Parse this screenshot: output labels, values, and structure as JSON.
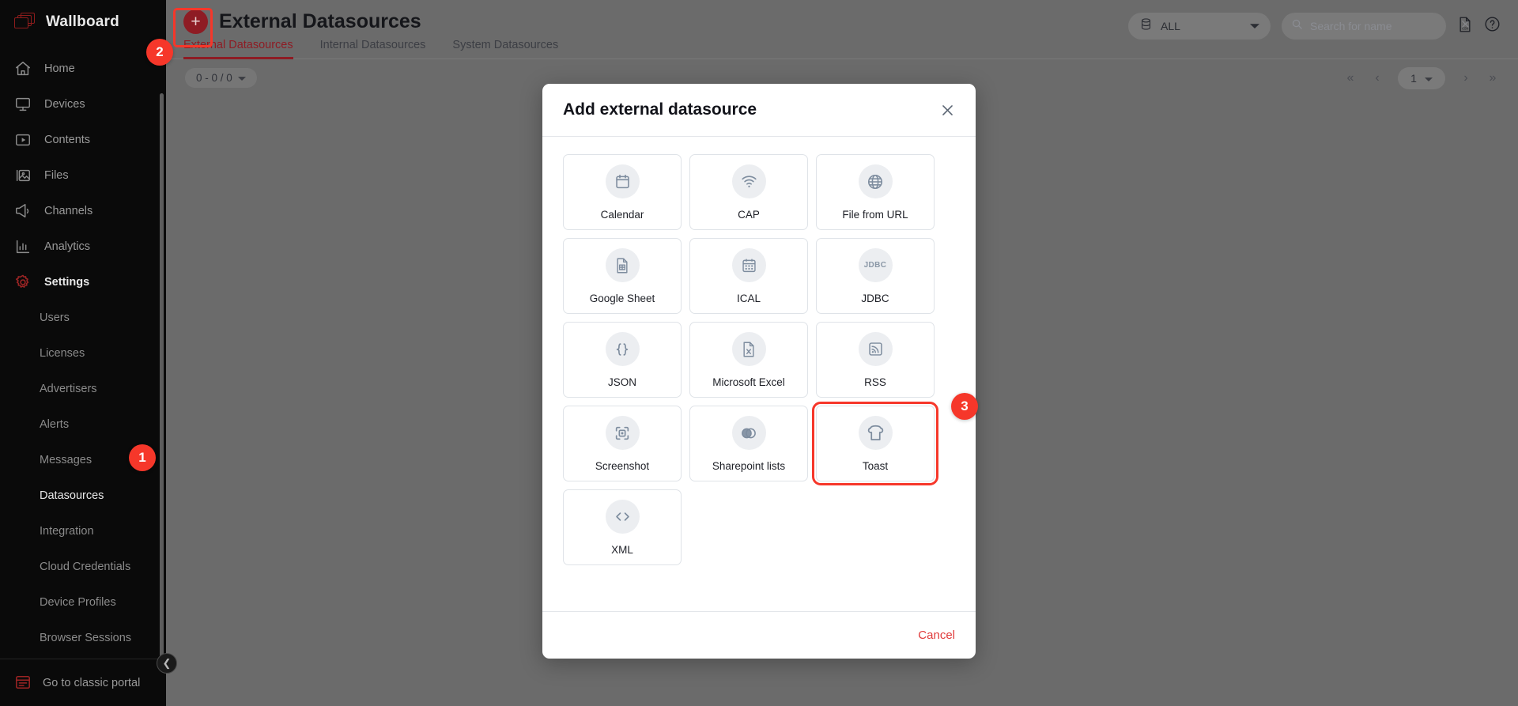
{
  "app": {
    "brand": "Wallboard"
  },
  "sidebar": {
    "main_items": [
      {
        "label": "Home",
        "icon": "home-icon"
      },
      {
        "label": "Devices",
        "icon": "monitor-icon"
      },
      {
        "label": "Contents",
        "icon": "play-box-icon"
      },
      {
        "label": "Files",
        "icon": "image-icon"
      },
      {
        "label": "Channels",
        "icon": "megaphone-icon"
      },
      {
        "label": "Analytics",
        "icon": "bar-chart-icon"
      },
      {
        "label": "Settings",
        "icon": "gear-icon"
      }
    ],
    "sub_items": [
      {
        "label": "Users"
      },
      {
        "label": "Licenses"
      },
      {
        "label": "Advertisers"
      },
      {
        "label": "Alerts"
      },
      {
        "label": "Messages"
      },
      {
        "label": "Datasources"
      },
      {
        "label": "Integration"
      },
      {
        "label": "Cloud Credentials"
      },
      {
        "label": "Device Profiles"
      },
      {
        "label": "Browser Sessions"
      }
    ],
    "selected_sub_item": "Datasources",
    "footer": {
      "label": "Go to classic portal",
      "icon": "classic-portal-icon"
    },
    "collapse_icon": "chevron-left-icon"
  },
  "header": {
    "title": "External Datasources",
    "add_button_icon": "plus-icon",
    "tabs": [
      {
        "label": "External Datasources",
        "active": true
      },
      {
        "label": "Internal Datasources",
        "active": false
      },
      {
        "label": "System Datasources",
        "active": false
      }
    ],
    "scope_select": {
      "value": "ALL",
      "icon": "database-icon",
      "chevron": "chevron-down-icon"
    },
    "search": {
      "value": "",
      "placeholder": "Search for name",
      "icon": "search-icon",
      "clear_icon": "close-icon"
    },
    "export_icon": "csv-file-icon",
    "help_icon": "help-circle-icon"
  },
  "list_toolbar": {
    "count_label": "0 - 0 / 0",
    "count_chevron": "chevron-down-icon",
    "pager": {
      "first_icon": "chevrons-left-icon",
      "prev_icon": "chevron-left-icon",
      "page_value": "1",
      "page_chevron": "chevron-down-icon",
      "next_icon": "chevron-right-icon",
      "last_icon": "chevrons-right-icon"
    }
  },
  "modal": {
    "title": "Add external datasource",
    "close_icon": "close-icon",
    "cancel_label": "Cancel",
    "tiles": [
      {
        "label": "Calendar",
        "icon": "calendar-icon",
        "highlighted": false
      },
      {
        "label": "CAP",
        "icon": "signal-wifi-icon",
        "highlighted": false
      },
      {
        "label": "File from URL",
        "icon": "globe-icon",
        "highlighted": false
      },
      {
        "label": "Google Sheet",
        "icon": "sheet-document-icon",
        "highlighted": false
      },
      {
        "label": "ICAL",
        "icon": "calendar-grid-icon",
        "highlighted": false
      },
      {
        "label": "JDBC",
        "icon": "jdbc-text-icon",
        "highlighted": false
      },
      {
        "label": "JSON",
        "icon": "braces-icon",
        "highlighted": false
      },
      {
        "label": "Microsoft Excel",
        "icon": "excel-file-icon",
        "highlighted": false
      },
      {
        "label": "RSS",
        "icon": "rss-icon",
        "highlighted": false
      },
      {
        "label": "Screenshot",
        "icon": "screenshot-frame-icon",
        "highlighted": false
      },
      {
        "label": "Sharepoint lists",
        "icon": "overlap-circles-icon",
        "highlighted": false
      },
      {
        "label": "Toast",
        "icon": "bread-slice-icon",
        "highlighted": true
      },
      {
        "label": "XML",
        "icon": "code-angle-icon",
        "highlighted": false
      }
    ]
  },
  "annotations": {
    "steps": [
      {
        "number": "1",
        "target": "sidebar-item-datasources"
      },
      {
        "number": "2",
        "target": "add-datasource-button"
      },
      {
        "number": "3",
        "target": "datasource-tile-toast"
      }
    ],
    "highlight_color": "#f6372a"
  },
  "colors": {
    "brand_red": "#8e1c24",
    "annotation_red": "#f6372a",
    "sidebar_bg": "#0a0a0a",
    "page_bg": "#6b6b6b",
    "modal_bg": "#ffffff",
    "cancel_red": "#e03a3a"
  }
}
